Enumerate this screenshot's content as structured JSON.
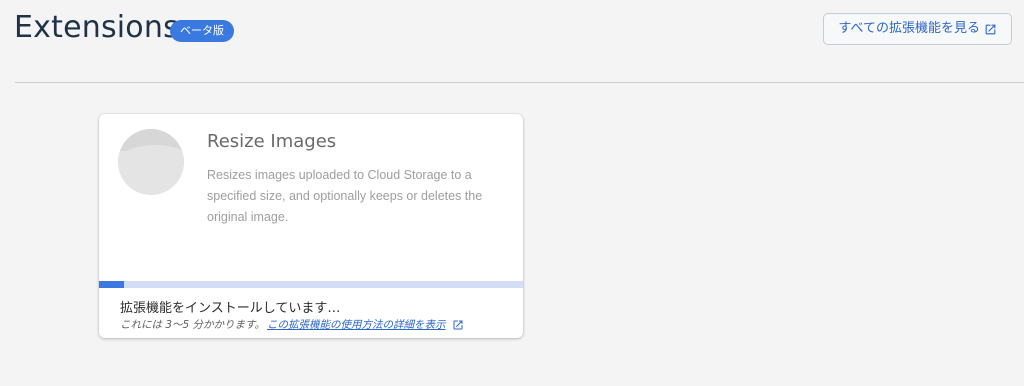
{
  "header": {
    "title": "Extensions",
    "badge": "ベータ版",
    "view_all_label": "すべての拡張機能を見る",
    "view_all_icon": "open-in-new-icon"
  },
  "card": {
    "name": "Resize Images",
    "description": "Resizes images uploaded to Cloud Storage to a specified size, and optionally keeps or deletes the original image.",
    "progress_fraction": 0.06,
    "status": "拡張機能をインストールしています…",
    "status_note": "これには 3〜5 分かかります。",
    "doc_link": "この拡張機能の使用方法の詳細を表示",
    "doc_link_icon": "open-in-new-icon"
  },
  "colors": {
    "accent": "#3a79e0",
    "progress_track": "#d3ddf3",
    "title": "#1f3348",
    "link": "#2b66c9"
  }
}
